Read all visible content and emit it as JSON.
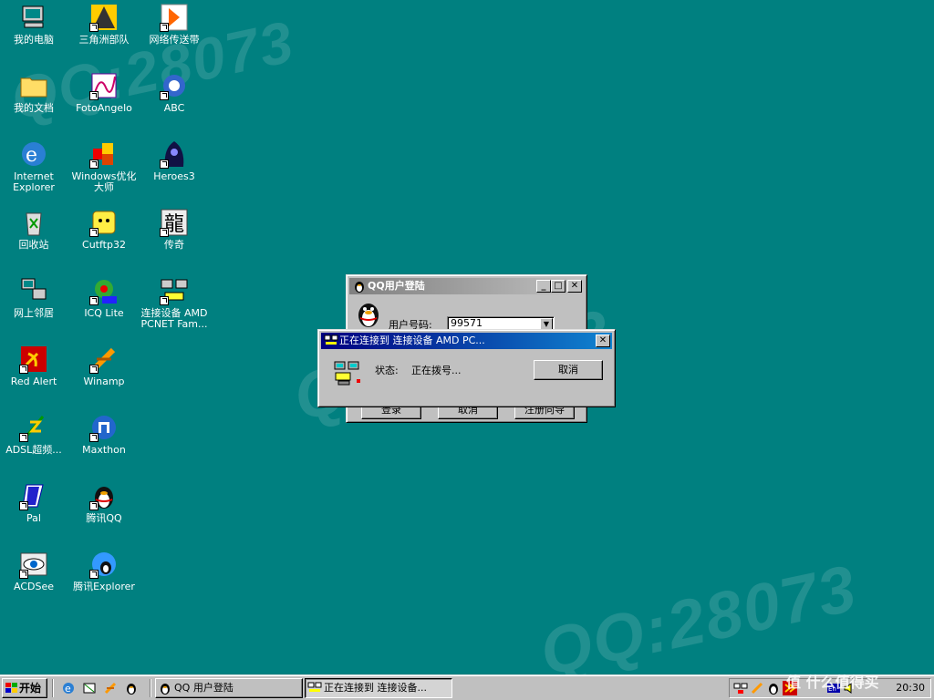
{
  "watermark": "QQ:28073",
  "desktop_icons": [
    {
      "label": "我的电脑"
    },
    {
      "label": "三角洲部队"
    },
    {
      "label": "网络传送带"
    },
    {
      "label": "我的文档"
    },
    {
      "label": "FotoAngelo"
    },
    {
      "label": "ABC"
    },
    {
      "label": "Internet Explorer"
    },
    {
      "label": "Windows优化大师"
    },
    {
      "label": "Heroes3"
    },
    {
      "label": "回收站"
    },
    {
      "label": "Cutftp32"
    },
    {
      "label": "传奇"
    },
    {
      "label": "网上邻居"
    },
    {
      "label": "ICQ Lite"
    },
    {
      "label": "连接设备 AMD PCNET Fam..."
    },
    {
      "label": "Red Alert"
    },
    {
      "label": "Winamp"
    },
    {
      "label": "ADSL超频..."
    },
    {
      "label": "Maxthon"
    },
    {
      "label": "Pal"
    },
    {
      "label": "腾讯QQ"
    },
    {
      "label": "ACDSee"
    },
    {
      "label": "腾讯Explorer"
    }
  ],
  "qq_login": {
    "title": "QQ用户登陆",
    "user_label": "用户号码:",
    "user_value": "99571",
    "buttons": [
      "登录",
      "取消",
      "注册向导"
    ]
  },
  "connect_dialog": {
    "title": "正在连接到 连接设备 AMD PC...",
    "status_label": "状态:",
    "status_value": "正在拨号...",
    "cancel_label": "取消"
  },
  "taskbar": {
    "start_label": "开始",
    "tasks": [
      {
        "label": "QQ 用户登陆"
      },
      {
        "label": "正在连接到 连接设备..."
      }
    ],
    "clock": "20:30"
  },
  "corner_watermark": "值 什么值得买"
}
